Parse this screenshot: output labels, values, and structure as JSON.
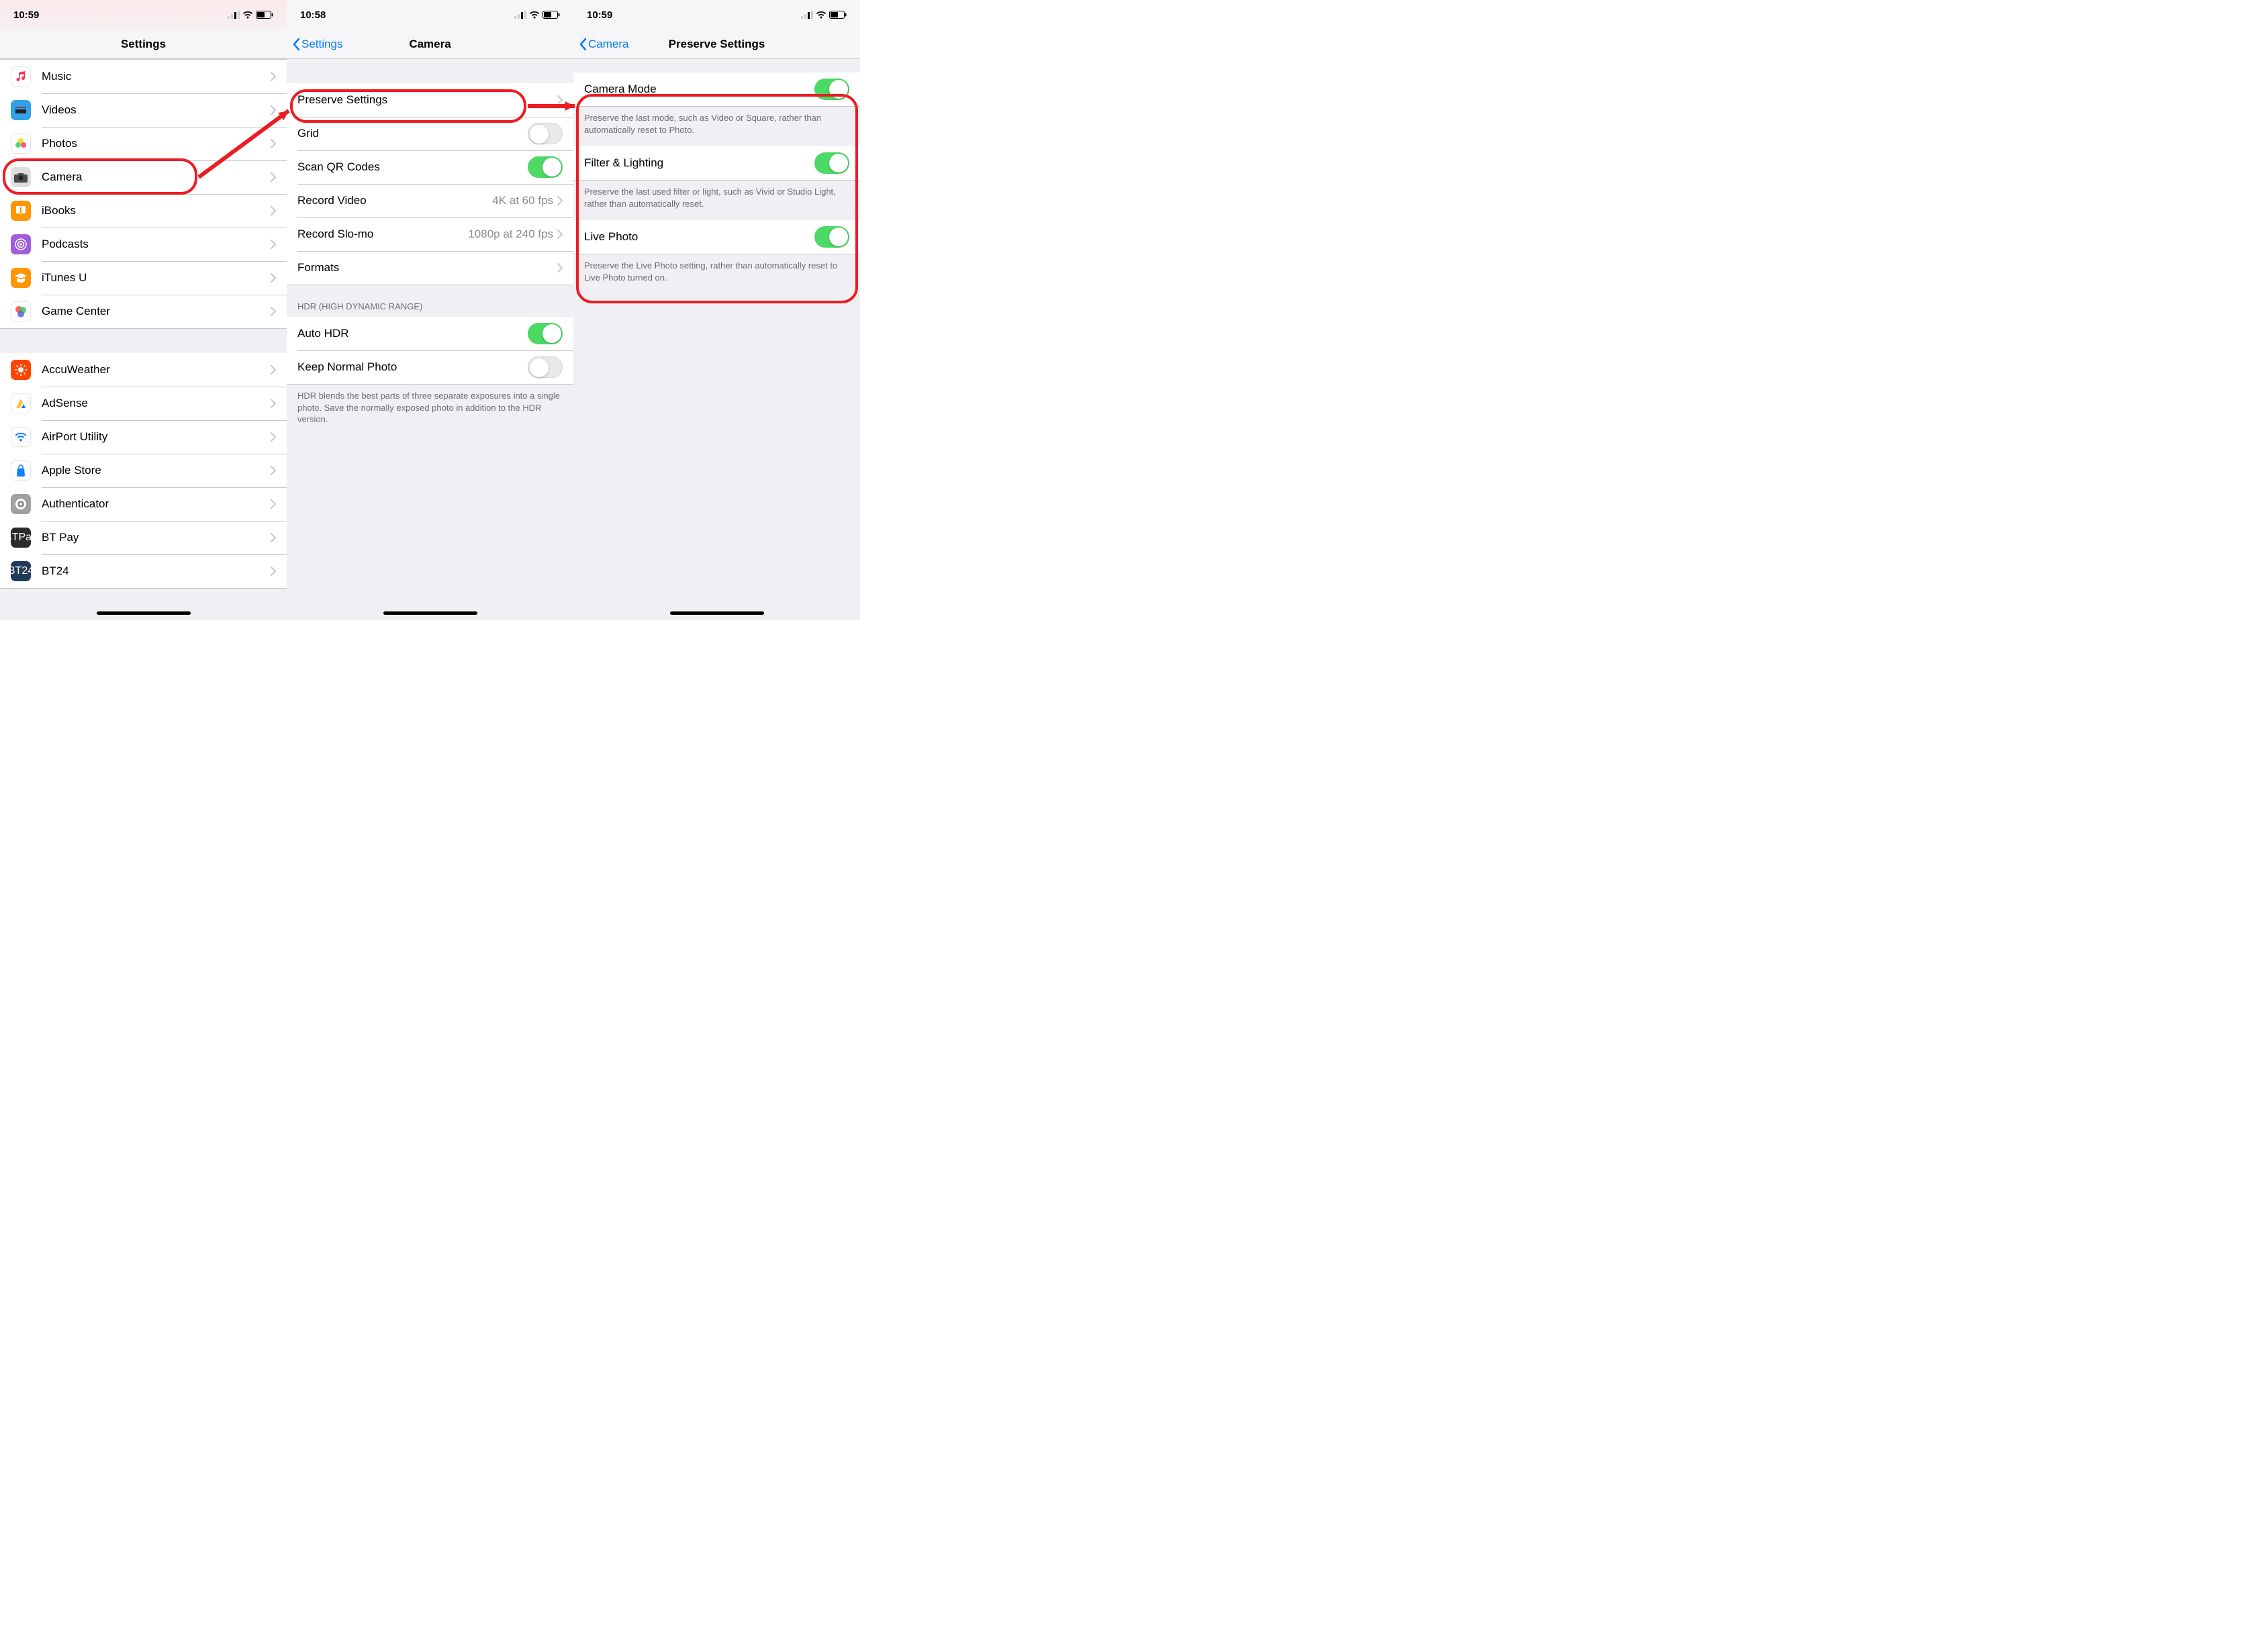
{
  "screens": [
    {
      "time": "10:59",
      "title": "Settings",
      "back": null,
      "groups": [
        {
          "items": [
            {
              "icon": "music",
              "color": "#ffffff",
              "fg": "#ff2d55",
              "label": "Music"
            },
            {
              "icon": "videos",
              "color": "#33a0e8",
              "label": "Videos"
            },
            {
              "icon": "photos",
              "color": "#ffffff",
              "fg": "#fdc02f",
              "label": "Photos"
            },
            {
              "icon": "camera",
              "color": "#dedede",
              "fg": "#2b2b2b",
              "label": "Camera",
              "highlight": true
            },
            {
              "icon": "ibooks",
              "color": "#ff9500",
              "label": "iBooks"
            },
            {
              "icon": "podcasts",
              "color": "#a05cdb",
              "label": "Podcasts"
            },
            {
              "icon": "itunesu",
              "color": "#ff9500",
              "label": "iTunes U"
            },
            {
              "icon": "gamecenter",
              "color": "#ffffff",
              "fg": "#5856d6",
              "label": "Game Center"
            }
          ]
        },
        {
          "items": [
            {
              "icon": "accuweather",
              "color": "#ff4500",
              "label": "AccuWeather"
            },
            {
              "icon": "adsense",
              "color": "#ffffff",
              "fg": "#fdc02f",
              "label": "AdSense"
            },
            {
              "icon": "airport",
              "color": "#ffffff",
              "fg": "#007aff",
              "label": "AirPort Utility"
            },
            {
              "icon": "applestore",
              "color": "#ffffff",
              "fg": "#0b84ff",
              "label": "Apple Store"
            },
            {
              "icon": "authenticator",
              "color": "#a0a0a0",
              "label": "Authenticator"
            },
            {
              "icon": "btpay",
              "color": "#2b2b2b",
              "label": "BT Pay"
            },
            {
              "icon": "bt24",
              "color": "#1f3a5b",
              "label": "BT24"
            }
          ]
        }
      ]
    },
    {
      "time": "10:58",
      "title": "Camera",
      "back": "Settings",
      "groups": [
        {
          "items": [
            {
              "label": "Preserve Settings",
              "type": "link",
              "highlight": true
            },
            {
              "label": "Grid",
              "type": "toggle",
              "on": false
            },
            {
              "label": "Scan QR Codes",
              "type": "toggle",
              "on": true
            },
            {
              "label": "Record Video",
              "type": "link",
              "detail": "4K at 60 fps"
            },
            {
              "label": "Record Slo-mo",
              "type": "link",
              "detail": "1080p at 240 fps"
            },
            {
              "label": "Formats",
              "type": "link"
            }
          ]
        },
        {
          "header": "HDR (HIGH DYNAMIC RANGE)",
          "items": [
            {
              "label": "Auto HDR",
              "type": "toggle",
              "on": true
            },
            {
              "label": "Keep Normal Photo",
              "type": "toggle",
              "on": false
            }
          ],
          "footer": "HDR blends the best parts of three separate exposures into a single photo. Save the normally exposed photo in addition to the HDR version."
        }
      ]
    },
    {
      "time": "10:59",
      "title": "Preserve Settings",
      "back": "Camera",
      "groups": [
        {
          "items": [
            {
              "label": "Camera Mode",
              "type": "toggle",
              "on": true
            }
          ],
          "footer": "Preserve the last mode, such as Video or Square, rather than automatically reset to Photo."
        },
        {
          "items": [
            {
              "label": "Filter & Lighting",
              "type": "toggle",
              "on": true
            }
          ],
          "footer": "Preserve the last used filter or light, such as Vivid or Studio Light, rather than automatically reset."
        },
        {
          "items": [
            {
              "label": "Live Photo",
              "type": "toggle",
              "on": true
            }
          ],
          "footer": "Preserve the Live Photo setting, rather than automatically reset to Live Photo turned on."
        }
      ],
      "highlight_group": true
    }
  ]
}
